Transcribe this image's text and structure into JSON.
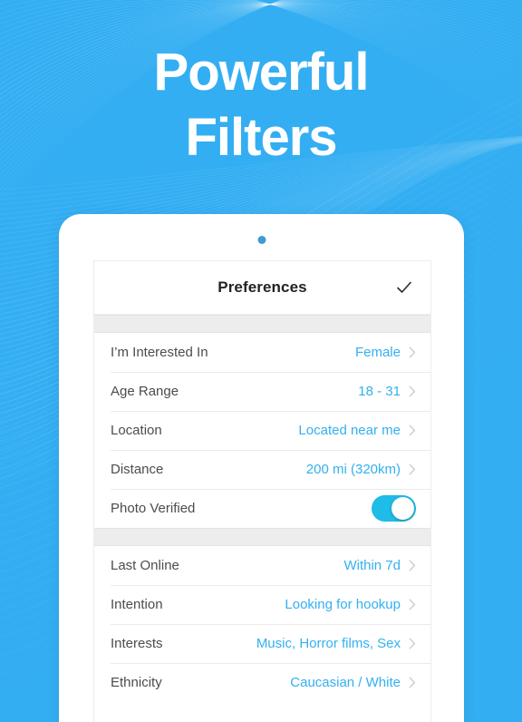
{
  "theme": {
    "background": "#33AEF2",
    "accent_value_color": "#33B0F0",
    "toggle_on_color": "#1FBCE8",
    "label_color": "#4C4C4C",
    "separator_color": "#EDEDED"
  },
  "headline": {
    "line1": "Powerful",
    "line2": "Filters"
  },
  "device": {
    "camera_icon": "camera-dot"
  },
  "screen": {
    "nav": {
      "title": "Preferences",
      "confirm_icon": "check-icon"
    },
    "groups": [
      {
        "rows": [
          {
            "label": "I’m Interested In",
            "value": "Female",
            "type": "disclosure",
            "accessory_icon": "chevron-right-icon"
          },
          {
            "label": "Age Range",
            "value": "18 - 31",
            "type": "disclosure",
            "accessory_icon": "chevron-right-icon"
          },
          {
            "label": "Location",
            "value": "Located near me",
            "type": "disclosure",
            "accessory_icon": "chevron-right-icon"
          },
          {
            "label": "Distance",
            "value": "200 mi (320km)",
            "type": "disclosure",
            "accessory_icon": "chevron-right-icon"
          },
          {
            "label": "Photo Verified",
            "value": "",
            "type": "toggle",
            "toggle_on": true,
            "accessory_icon": "toggle-switch"
          }
        ]
      },
      {
        "rows": [
          {
            "label": "Last Online",
            "value": "Within 7d",
            "type": "disclosure",
            "accessory_icon": "chevron-right-icon"
          },
          {
            "label": "Intention",
            "value": "Looking for hookup",
            "type": "disclosure",
            "accessory_icon": "chevron-right-icon"
          },
          {
            "label": "Interests",
            "value": "Music, Horror films, Sex",
            "type": "disclosure",
            "accessory_icon": "chevron-right-icon"
          },
          {
            "label": "Ethnicity",
            "value": "Caucasian / White",
            "type": "disclosure",
            "accessory_icon": "chevron-right-icon"
          }
        ]
      }
    ]
  }
}
